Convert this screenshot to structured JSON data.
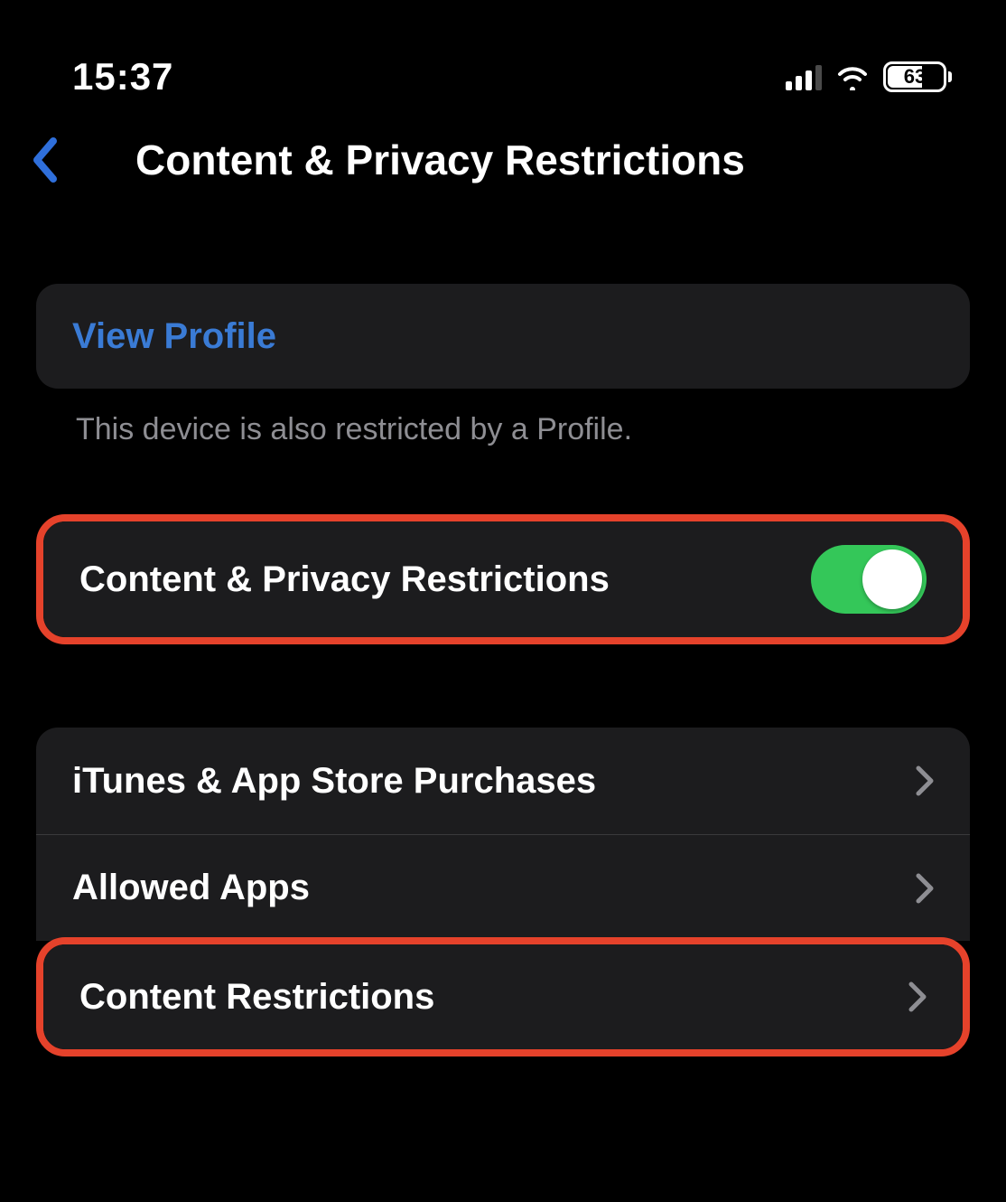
{
  "status": {
    "time": "15:37",
    "battery": "63"
  },
  "nav": {
    "title": "Content & Privacy Restrictions"
  },
  "profile": {
    "view_label": "View Profile",
    "note": "This device is also restricted by a Profile."
  },
  "toggle_row": {
    "label": "Content & Privacy Restrictions",
    "enabled": true
  },
  "list": {
    "itunes": "iTunes & App Store Purchases",
    "allowed": "Allowed Apps",
    "content": "Content Restrictions"
  },
  "colors": {
    "accent_blue": "#3a7bd5",
    "toggle_green": "#34c759",
    "highlight": "#e5422b",
    "cell_bg": "#1c1c1e"
  }
}
